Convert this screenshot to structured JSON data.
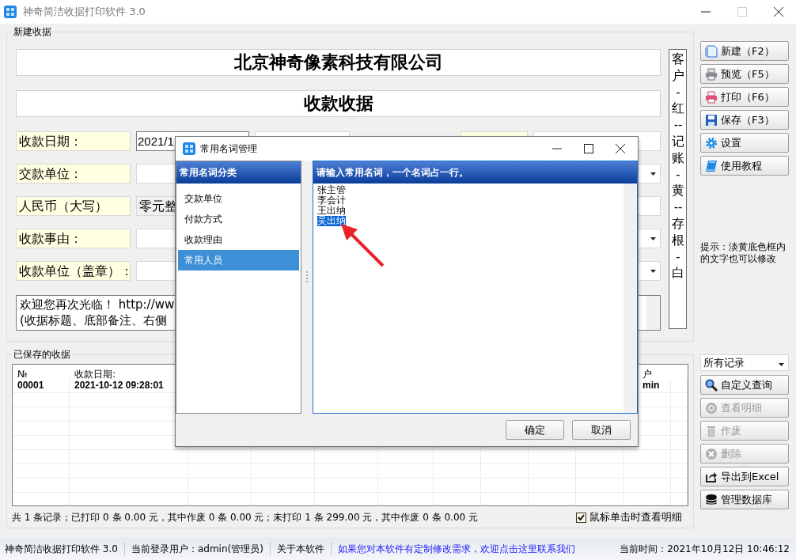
{
  "window": {
    "title": "神奇简洁收据打印软件 3.0"
  },
  "new_receipt": {
    "title": "新建收据",
    "company": "北京神奇像素科技有限公司",
    "receipt_title": "收款收据",
    "fields": [
      {
        "label": "收款日期：",
        "value": "2021/1",
        "kind": "date"
      },
      {
        "label": "交款单位：",
        "kind": "dropdown"
      },
      {
        "label": "人民币（大写）",
        "value": "零元整",
        "kind": "readonly"
      },
      {
        "label": "收款事由：",
        "kind": "dropdown"
      },
      {
        "label": "收款单位（盖章）：",
        "kind": "dropdown"
      }
    ],
    "memo": [
      "欢迎您再次光临！ http://ww",
      "(收据标题、底部备注、右侧"
    ],
    "copies_strip": "客户-红--记账-黄--存根-白"
  },
  "actions": [
    {
      "label": "新建（F2）"
    },
    {
      "label": "预览（F5）"
    },
    {
      "label": "打印（F6）"
    },
    {
      "label": "保存（F3）"
    },
    {
      "label": "设置"
    },
    {
      "label": "使用教程"
    }
  ],
  "hint": "提示：淡黄底色框内的文字也可以修改",
  "saved": {
    "title": "已保存的收据",
    "columns": [
      "№",
      "收款日期:",
      "户"
    ],
    "rows": [
      {
        "cells": [
          "00001",
          "2021-10-12 09:28:01",
          "min"
        ]
      }
    ],
    "summary": "共 1 条记录；已打印 0 条 0.00 元，其中作废 0 条 0.00 元；未打印 1 条 299.00 元，其中作废 0 条 0.00 元",
    "click_detail": {
      "label": "鼠标单击时查看明细",
      "checked": true
    }
  },
  "filter": {
    "value": "所有记录"
  },
  "query_actions": [
    {
      "label": "自定义查询",
      "disabled": false
    },
    {
      "label": "查看明细",
      "disabled": true
    },
    {
      "label": "作废",
      "disabled": true
    },
    {
      "label": "删除",
      "disabled": true
    },
    {
      "label": "导出到Excel",
      "disabled": false
    },
    {
      "label": "管理数据库",
      "disabled": false
    }
  ],
  "status_bar": {
    "app": "神奇简洁收据打印软件 3.0",
    "user": "当前登录用户：admin(管理员)",
    "about": "关于本软件",
    "contact": "如果您对本软件有定制修改需求，欢迎点击这里联系我们",
    "time": "当前时间：2021年10月12日 10:46:12"
  },
  "dialog": {
    "title": "常用名词管理",
    "categories_header": "常用名词分类",
    "categories": [
      {
        "label": "交款单位",
        "selected": false
      },
      {
        "label": "付款方式",
        "selected": false
      },
      {
        "label": "收款理由",
        "selected": false
      },
      {
        "label": "常用人员",
        "selected": true
      }
    ],
    "entries_header": "请输入常用名词，一个名词占一行。",
    "entries": [
      {
        "text": "张主管",
        "selected": false
      },
      {
        "text": "李会计",
        "selected": false
      },
      {
        "text": "王出纳",
        "selected": false
      },
      {
        "text": "吴出纳",
        "selected": true
      }
    ],
    "buttons": [
      "确定",
      "取消"
    ]
  }
}
